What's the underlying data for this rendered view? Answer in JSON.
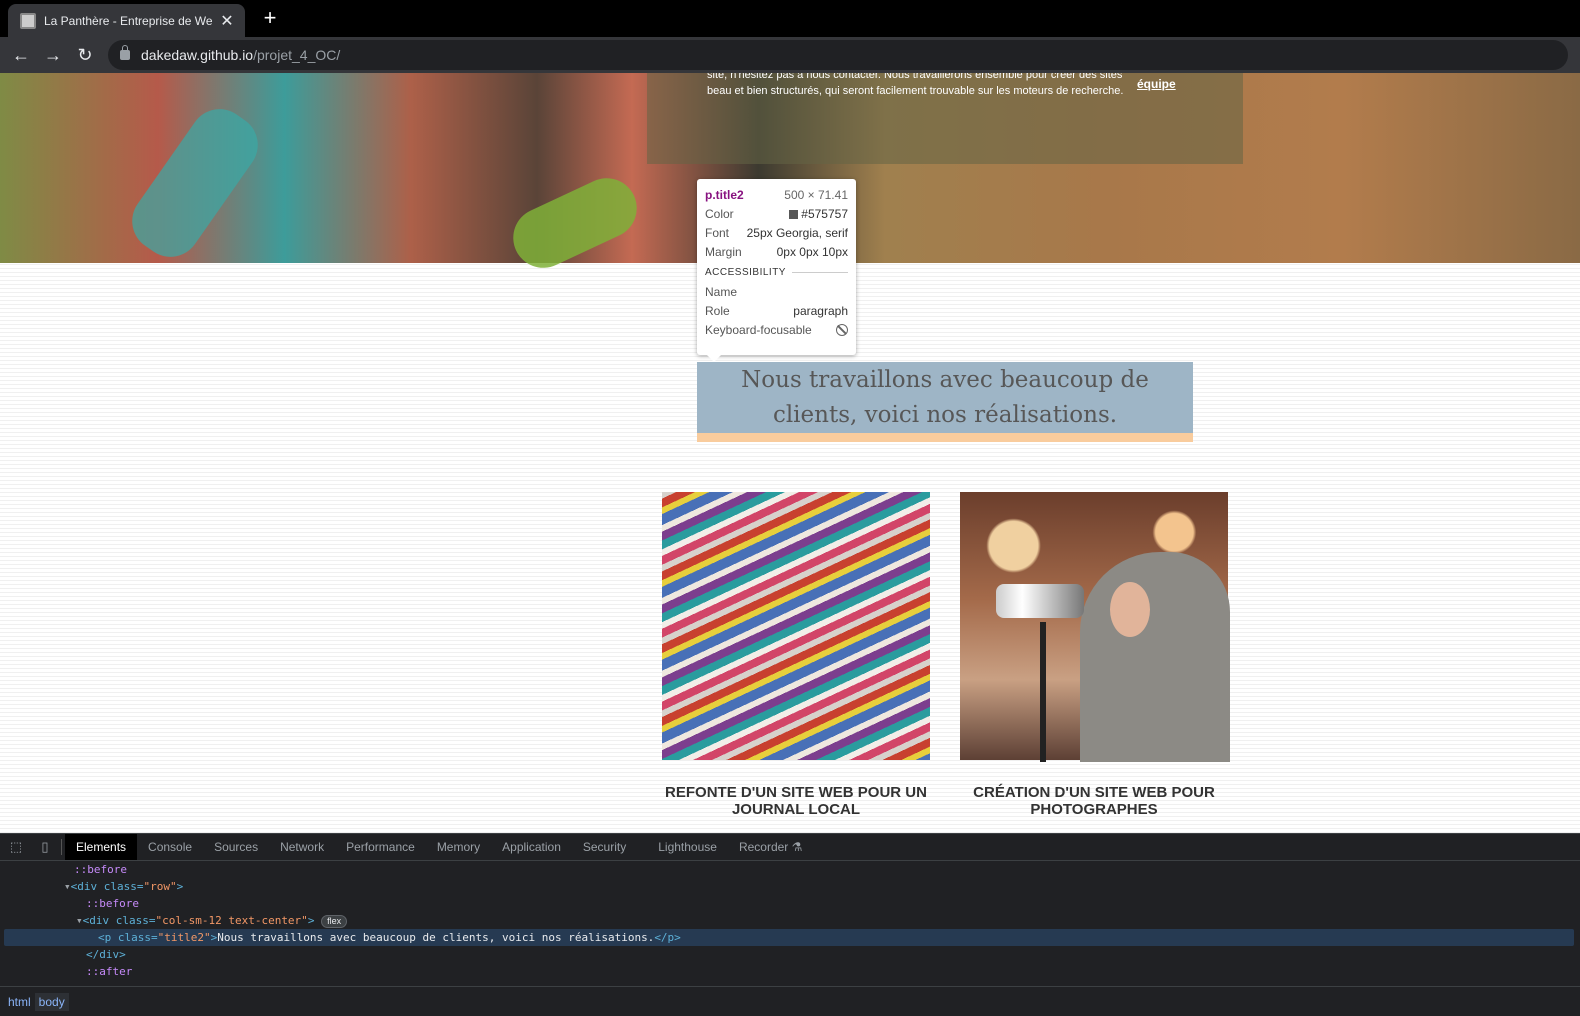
{
  "browser": {
    "tab_title": "La Panthère - Entreprise de Web",
    "close_glyph": "✕",
    "new_tab_glyph": "+",
    "url_host": "dakedaw.github.io",
    "url_path": "/projet_4_OC/",
    "back_glyph": "←",
    "forward_glyph": "→",
    "reload_glyph": "↻"
  },
  "page": {
    "hero_text": "site, n'hésitez pas à nous contacter. Nous travaillerons ensemble pour créer des sites beau et bien structurés, qui seront facilement trouvable sur les moteurs de recherche.",
    "hero_link": "équipe",
    "title2": "Nous travaillons avec beaucoup de clients, voici nos réalisations.",
    "cards": [
      {
        "title": "REFONTE D'UN SITE WEB POUR UN JOURNAL LOCAL"
      },
      {
        "title": "CRÉATION D'UN SITE WEB POUR PHOTOGRAPHES"
      }
    ]
  },
  "tooltip": {
    "selector": "p.title2",
    "dimensions": "500 × 71.41",
    "color_label": "Color",
    "color_value": "#575757",
    "font_label": "Font",
    "font_value": "25px Georgia, serif",
    "margin_label": "Margin",
    "margin_value": "0px 0px 10px",
    "section": "ACCESSIBILITY",
    "name_label": "Name",
    "name_value": "",
    "role_label": "Role",
    "role_value": "paragraph",
    "focus_label": "Keyboard-focusable"
  },
  "devtools": {
    "tabs": [
      "Elements",
      "Console",
      "Sources",
      "Network",
      "Performance",
      "Memory",
      "Application",
      "Security",
      "Lighthouse",
      "Recorder ⚗"
    ],
    "active_tab": "Elements",
    "dom": {
      "l1": "::before",
      "l2_tag": "<div class=",
      "l2_val": "\"row\"",
      "l3": "::before",
      "l4_tag": "<div class=",
      "l4_val": "\"col-sm-12 text-center\"",
      "flex_badge": "flex",
      "l5_open": "<p class=",
      "l5_val": "\"title2\"",
      "l5_text": "Nous travaillons avec beaucoup de clients, voici nos réalisations.",
      "l5_close": "</p>",
      "l6": "</div>",
      "l7": "::after"
    },
    "breadcrumbs": [
      "html",
      "body"
    ]
  }
}
